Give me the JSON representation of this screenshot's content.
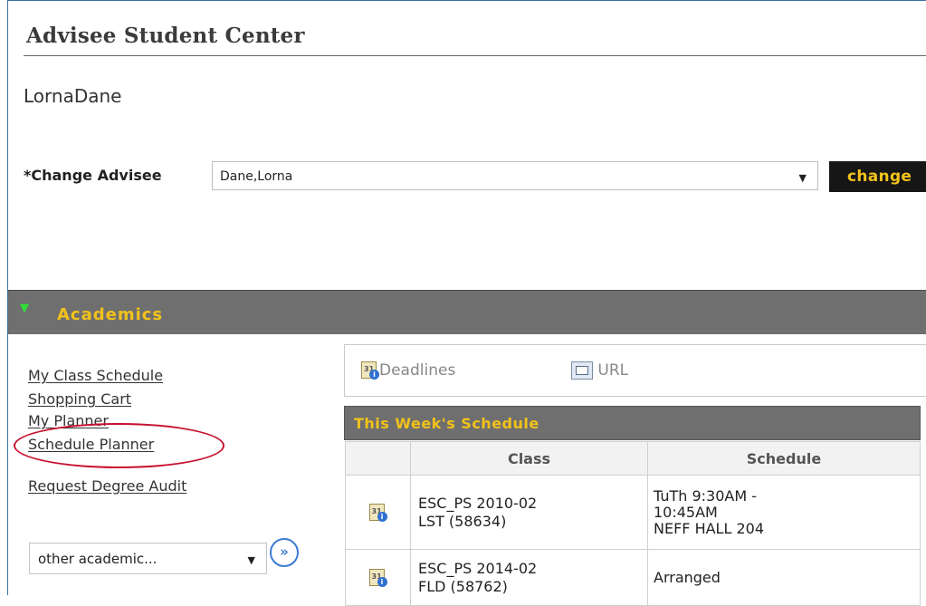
{
  "page": {
    "title": "Advisee Student Center",
    "student_name": "LornaDane"
  },
  "change_advisee": {
    "label": "*Change Advisee",
    "selected": "Dane,Lorna",
    "button_label": "change"
  },
  "academics": {
    "section_label": "Academics",
    "links": [
      {
        "label": "My Class Schedule"
      },
      {
        "label": "Shopping Cart"
      },
      {
        "label": "My Planner"
      },
      {
        "label": "Schedule Planner"
      },
      {
        "label": "Request Degree Audit"
      }
    ],
    "other_select": {
      "selected": "other academic..."
    },
    "toolbar": {
      "deadlines_label": "Deadlines",
      "url_label": "URL"
    },
    "schedule": {
      "title": "This Week's Schedule",
      "columns": [
        "Class",
        "Schedule"
      ],
      "rows": [
        {
          "class_line1": "ESC_PS 2010-02",
          "class_line2": "LST (58634)",
          "schedule_line1": "TuTh 9:30AM -",
          "schedule_line2": "10:45AM",
          "schedule_line3": "NEFF HALL 204"
        },
        {
          "class_line1": "ESC_PS 2014-02",
          "class_line2": "FLD (58762)",
          "schedule_line1": "Arranged"
        }
      ]
    }
  },
  "colors": {
    "accent": "#f2c21a",
    "section_bar": "#6f6f6f",
    "highlight_oval": "#c8102e",
    "triangle": "#2fe038"
  }
}
